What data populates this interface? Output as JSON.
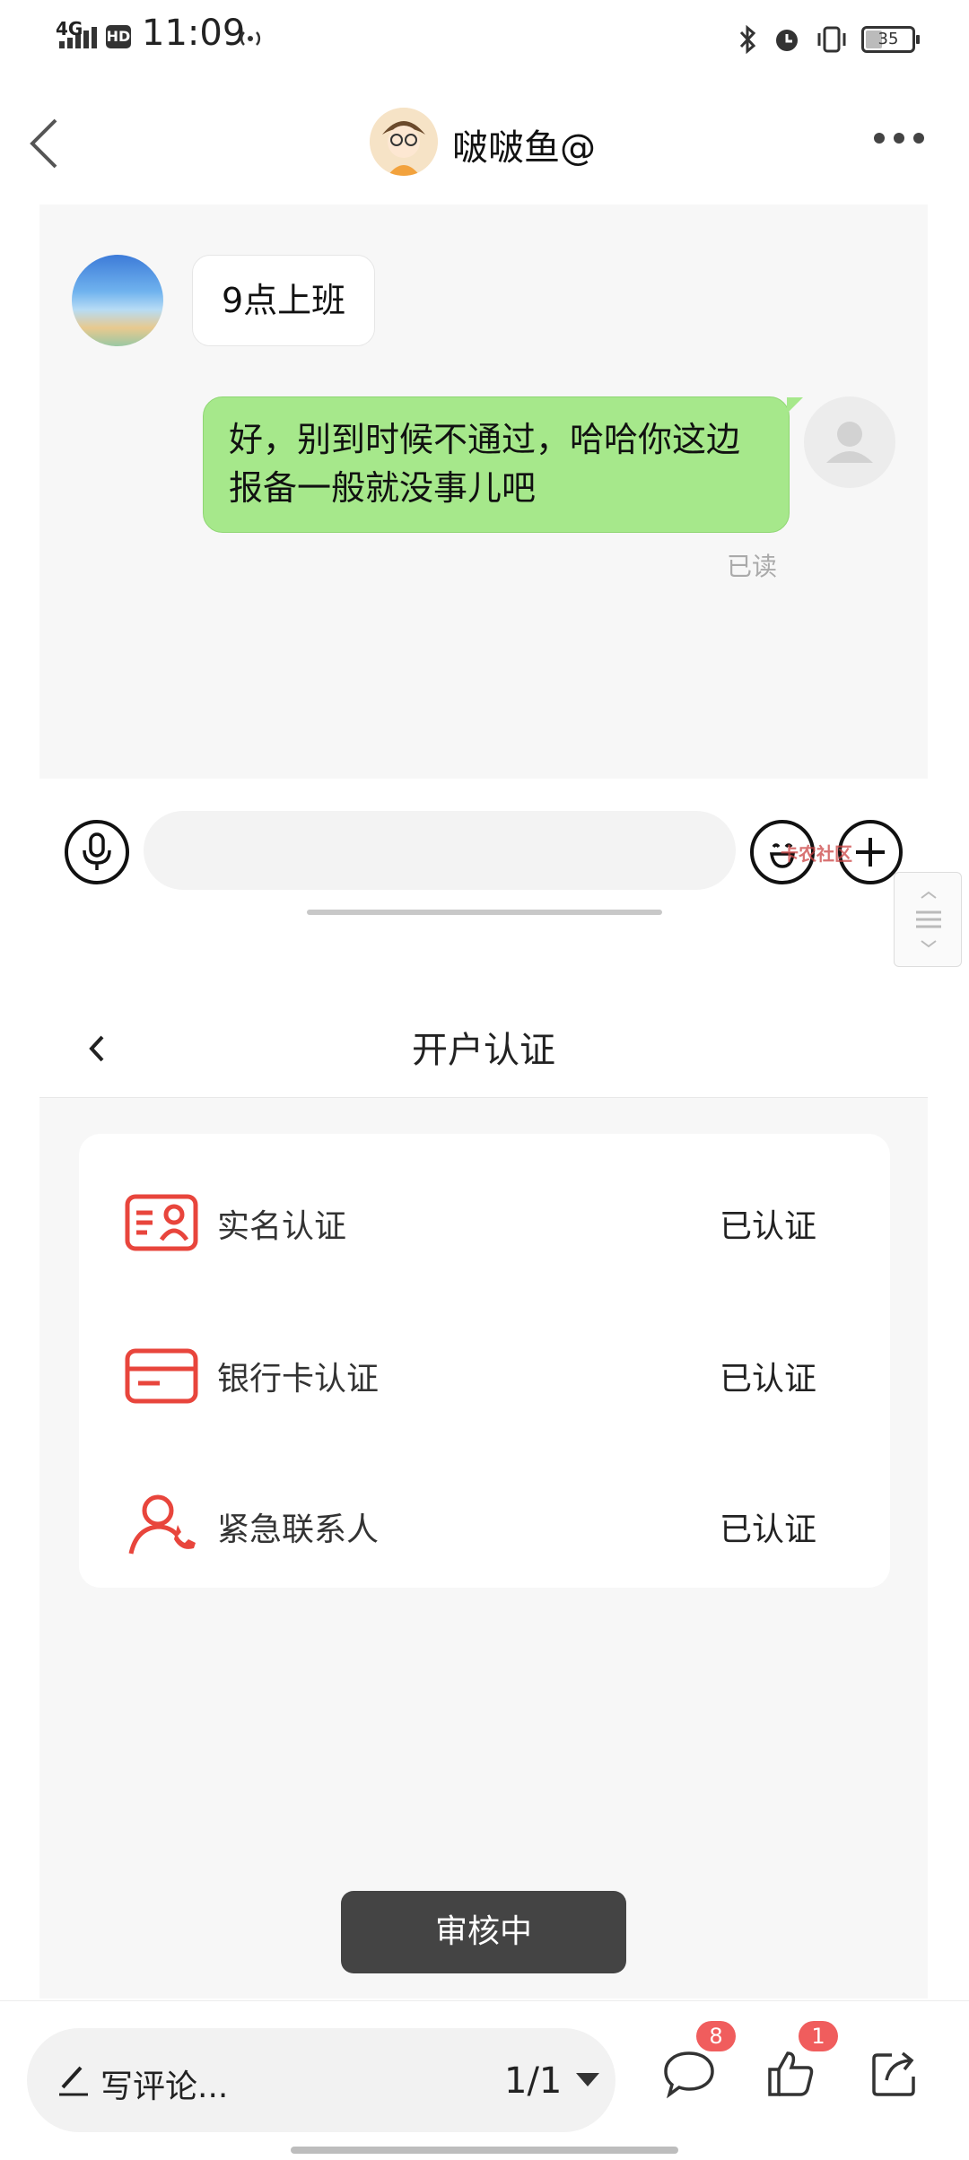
{
  "status_bar": {
    "network": "4G",
    "hd": "HD",
    "time": "11:09",
    "battery": "35",
    "battery_level": 0.35
  },
  "chat": {
    "contact_name": "啵啵鱼@",
    "messages": [
      {
        "side": "left",
        "text": "9点上班"
      },
      {
        "side": "right",
        "text": "好，别到时候不通过，哈哈你这边报备一般就没事儿吧",
        "status": "已读"
      }
    ],
    "input_placeholder": ""
  },
  "watermark": {
    "text": "卡农社区"
  },
  "verification": {
    "title": "开户认证",
    "items": [
      {
        "label": "实名认证",
        "status": "已认证",
        "icon": "id-card-icon"
      },
      {
        "label": "银行卡认证",
        "status": "已认证",
        "icon": "bank-card-icon"
      },
      {
        "label": "紧急联系人",
        "status": "已认证",
        "icon": "contact-phone-icon"
      }
    ],
    "review_button": "审核中"
  },
  "bottom_bar": {
    "comment_placeholder": "写评论...",
    "pager": "1/1",
    "comments_count": "8",
    "likes_count": "1"
  },
  "colors": {
    "accent_red": "#e8453c",
    "bubble_green": "#a6e88b",
    "badge_red": "#f05d5d",
    "review_button_bg": "#444444"
  }
}
